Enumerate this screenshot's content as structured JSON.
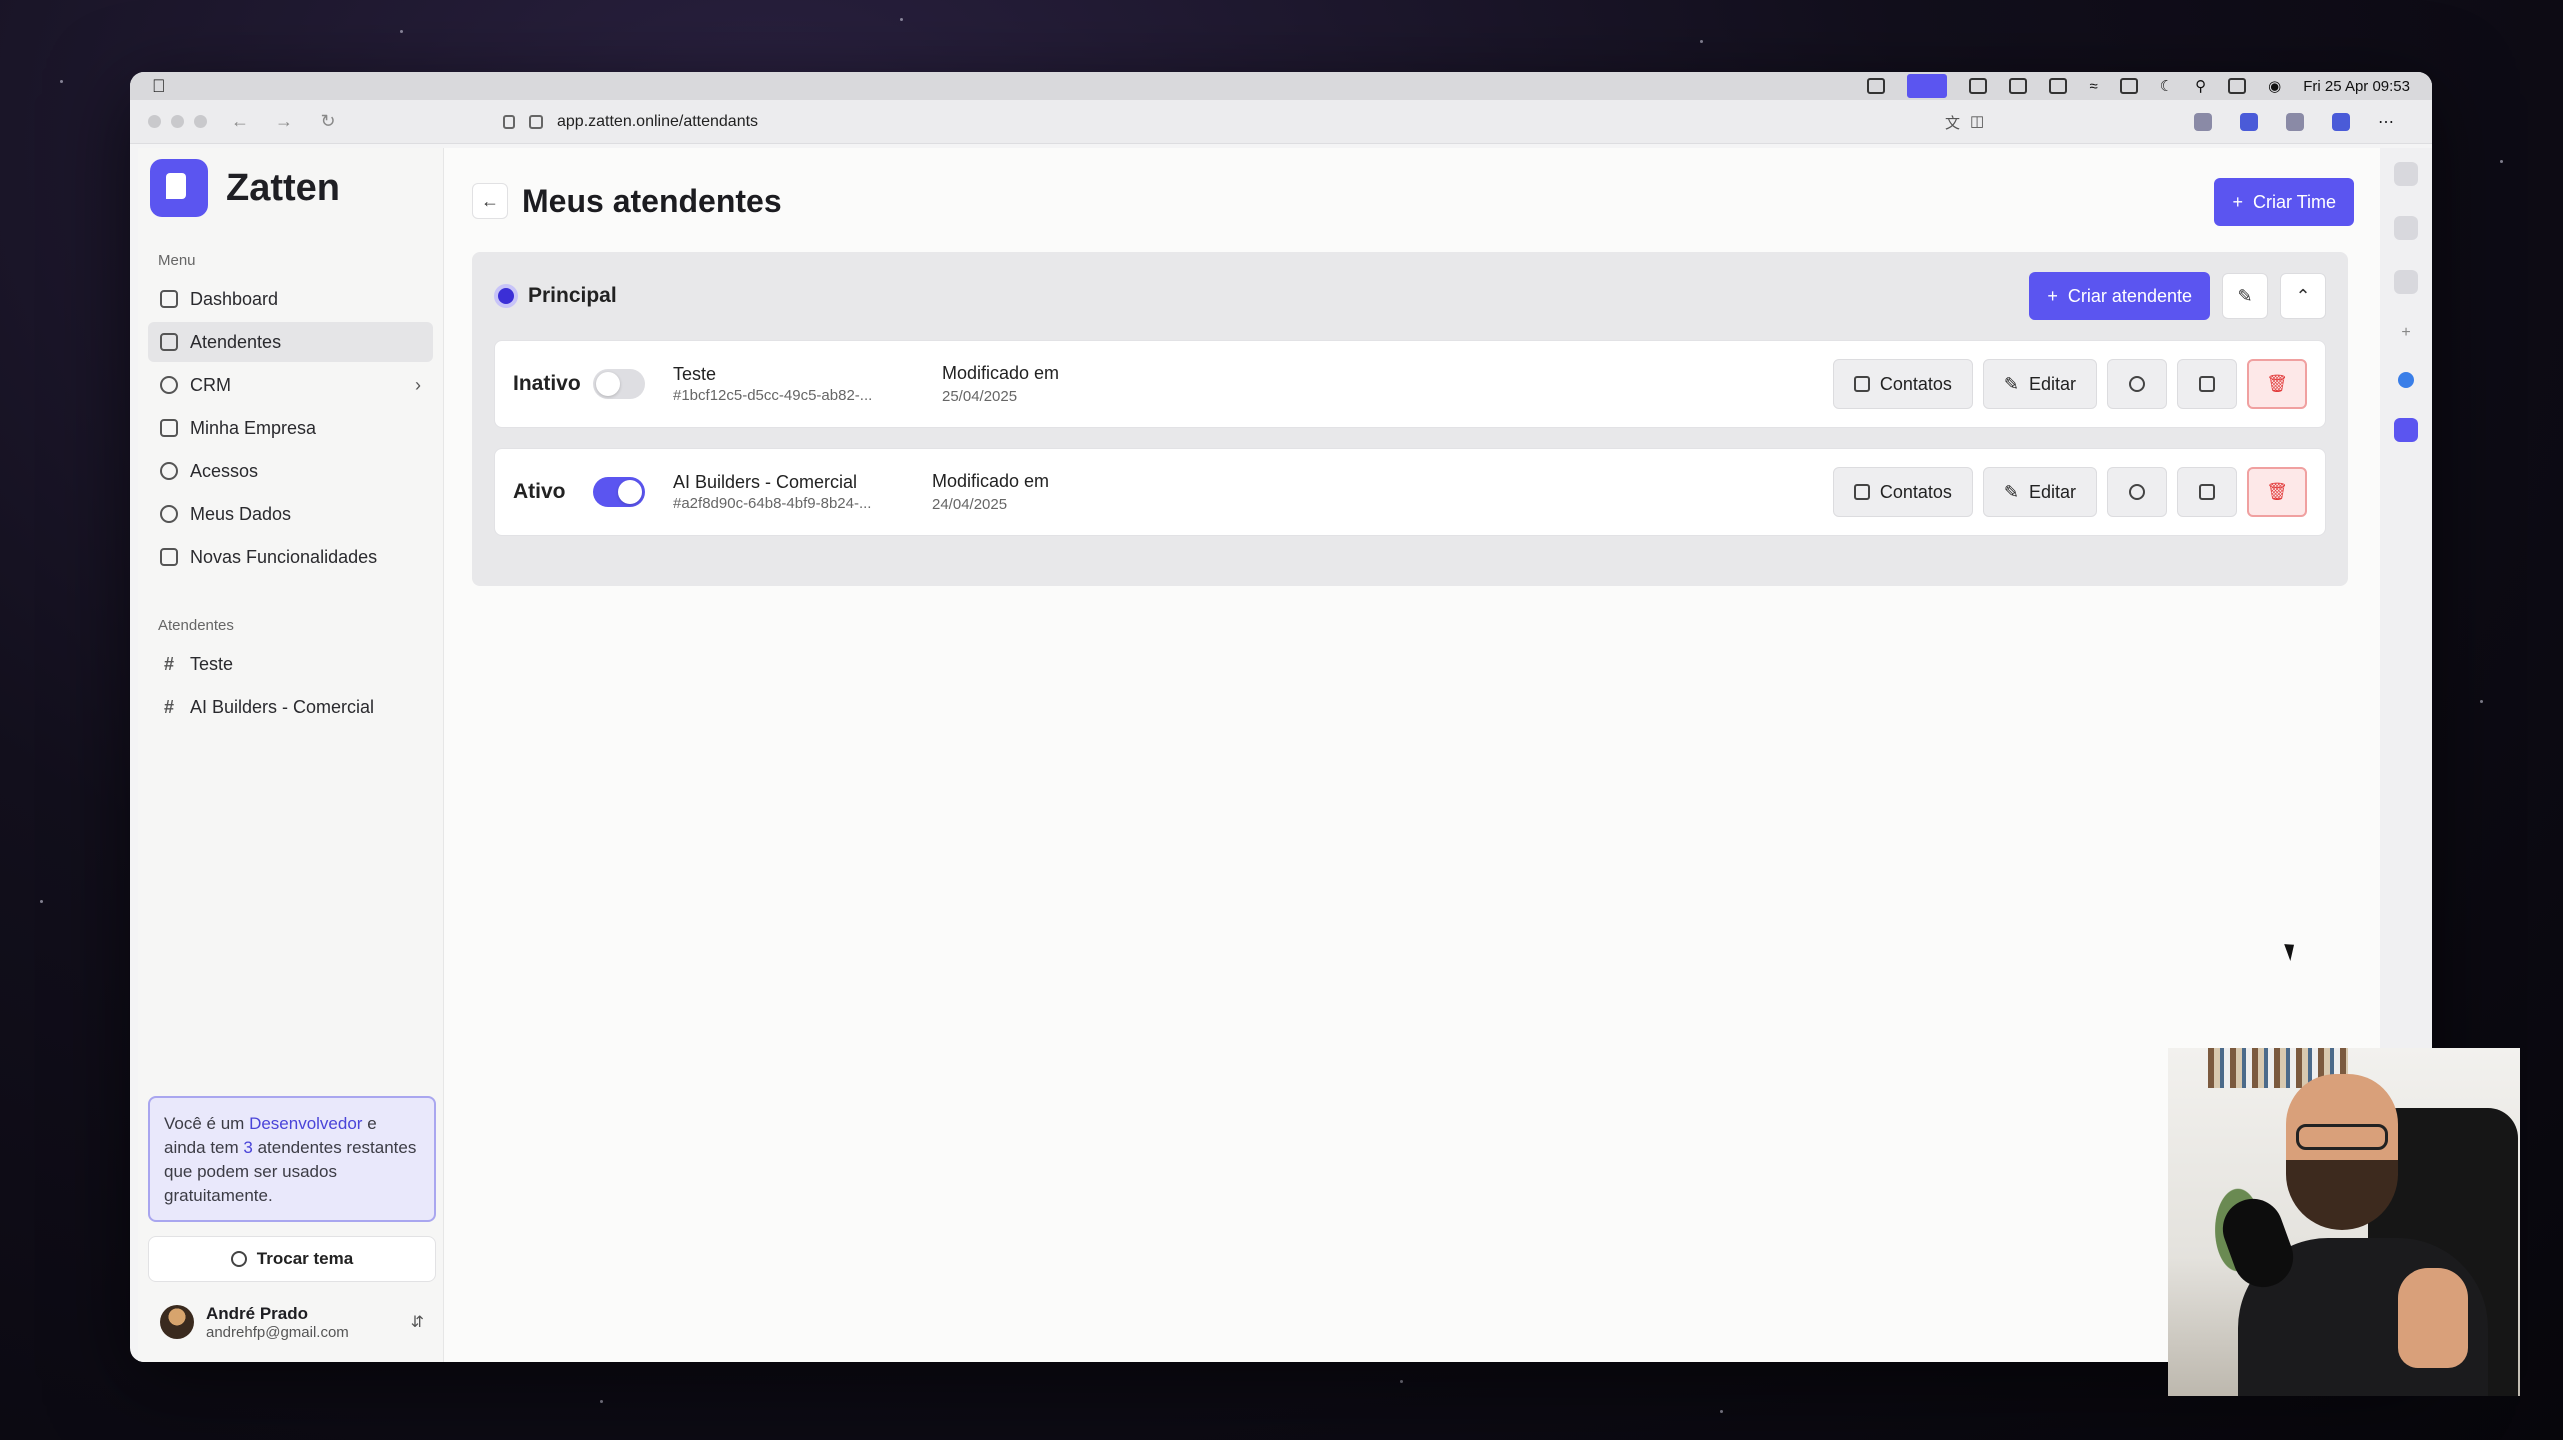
{
  "system": {
    "clock": "Fri 25 Apr  09:53",
    "url": "app.zatten.online/attendants"
  },
  "brand": {
    "name": "Zatten",
    "color": "#5b55f0"
  },
  "sidebar": {
    "menu_label": "Menu",
    "items": [
      {
        "label": "Dashboard",
        "icon": "grid-icon"
      },
      {
        "label": "Atendentes",
        "icon": "headset-icon",
        "active": true
      },
      {
        "label": "CRM",
        "icon": "target-icon",
        "has_submenu": true
      },
      {
        "label": "Minha Empresa",
        "icon": "building-icon"
      },
      {
        "label": "Acessos",
        "icon": "users-icon"
      },
      {
        "label": "Meus Dados",
        "icon": "gear-icon"
      },
      {
        "label": "Novas Funcionalidades",
        "icon": "rocket-icon"
      }
    ],
    "agents_label": "Atendentes",
    "agents": [
      {
        "label": "Teste"
      },
      {
        "label": "AI Builders - Comercial"
      }
    ],
    "upsell": {
      "prefix": "Você é um ",
      "role": "Desenvolvedor",
      "middle": " e ainda tem ",
      "count": "3",
      "suffix": " atendentes restantes que podem ser usados gratuitamente."
    },
    "theme_button": "Trocar tema",
    "user": {
      "name": "André Prado",
      "email": "andrehfp@gmail.com"
    }
  },
  "main": {
    "title": "Meus atendentes",
    "create_team_label": "Criar Time",
    "team": {
      "name": "Principal",
      "create_agent_label": "Criar atendente",
      "agents": [
        {
          "status": "Inativo",
          "active": false,
          "name": "Teste",
          "id": "#1bcf12c5-d5cc-49c5-ab82-...",
          "modified_label": "Modificado em",
          "modified_date": "25/04/2025"
        },
        {
          "status": "Ativo",
          "active": true,
          "name": "AI Builders - Comercial",
          "id": "#a2f8d90c-64b8-4bf9-8b24-...",
          "modified_label": "Modificado em",
          "modified_date": "24/04/2025"
        }
      ],
      "row_actions": {
        "contacts_label": "Contatos",
        "edit_label": "Editar"
      }
    }
  }
}
